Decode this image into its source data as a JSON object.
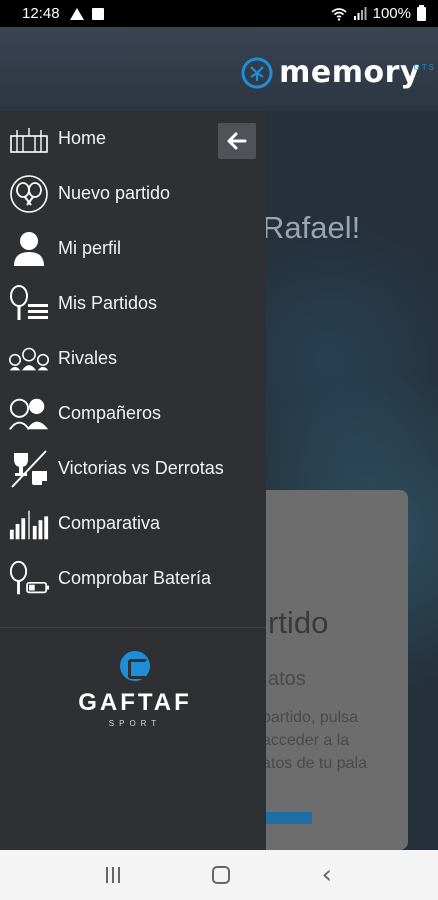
{
  "status_bar": {
    "time": "12:48",
    "battery_percent": "100%",
    "icons": [
      "warning-icon",
      "mail-icon",
      "wifi-icon",
      "signal-icon",
      "battery-icon"
    ]
  },
  "header": {
    "logo_text": "memory",
    "logo_sub": "GTS",
    "logo_icon": "brain-icon"
  },
  "background": {
    "greeting": "Rafael!",
    "card_title": "rtido",
    "card_subtitle": "atos",
    "card_text": "partido, pulsa\nacceder a la\natos de tu pala"
  },
  "drawer": {
    "back_icon": "arrow-left-icon",
    "items": [
      {
        "label": "Home",
        "icon": "stadium-icon"
      },
      {
        "label": "Nuevo partido",
        "icon": "rackets-icon"
      },
      {
        "label": "Mi perfil",
        "icon": "user-icon"
      },
      {
        "label": "Mis Partidos",
        "icon": "racket-list-icon"
      },
      {
        "label": "Rivales",
        "icon": "rivals-icon"
      },
      {
        "label": "Compañeros",
        "icon": "partners-icon"
      },
      {
        "label": "Victorias vs Derrotas",
        "icon": "trophy-thumbs-icon"
      },
      {
        "label": "Comparativa",
        "icon": "bar-charts-icon"
      },
      {
        "label": "Comprobar Batería",
        "icon": "racket-battery-icon"
      }
    ],
    "brand": {
      "name": "GAFTAF",
      "sub": "SPORT"
    }
  },
  "nav_bar": {
    "icons": [
      "recent-apps-icon",
      "home-icon",
      "back-icon"
    ]
  },
  "colors": {
    "accent": "#1e8fd6",
    "drawer_bg": "#2f3033",
    "app_bg": "#2a3340"
  }
}
